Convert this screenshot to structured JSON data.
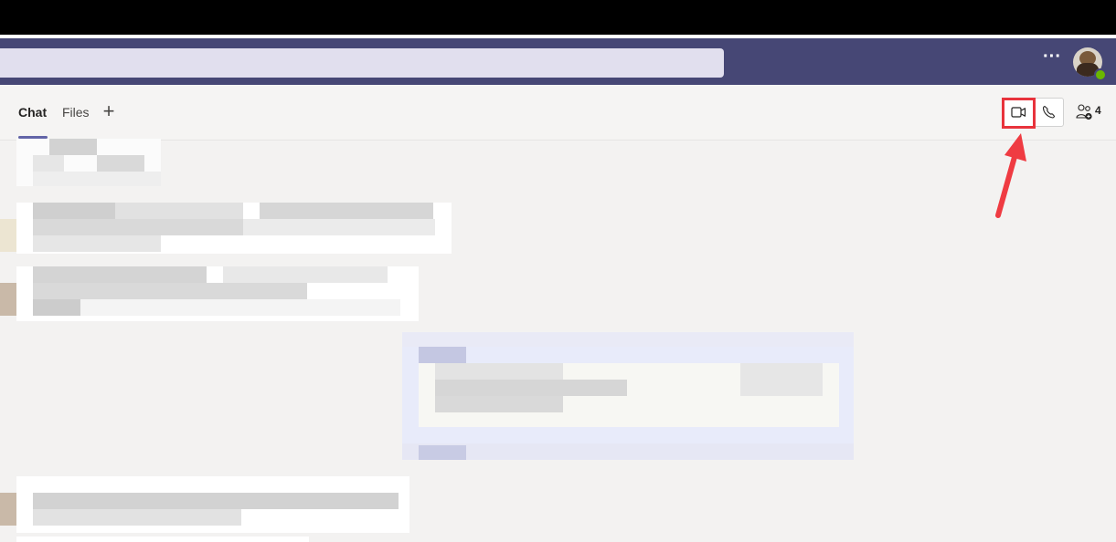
{
  "app_header": {
    "more_label": "···"
  },
  "chat_header": {
    "tabs": [
      {
        "label": "Chat",
        "active": true
      },
      {
        "label": "Files",
        "active": false
      }
    ],
    "add_tab_label": "+",
    "participants_count": "4",
    "icons": {
      "video": "video-camera-icon",
      "call": "phone-icon",
      "people": "people-add-icon"
    }
  },
  "colors": {
    "app_bar": "#464775",
    "accent": "#6264a7",
    "highlight": "#e8333c",
    "presence": "#6bb700"
  }
}
